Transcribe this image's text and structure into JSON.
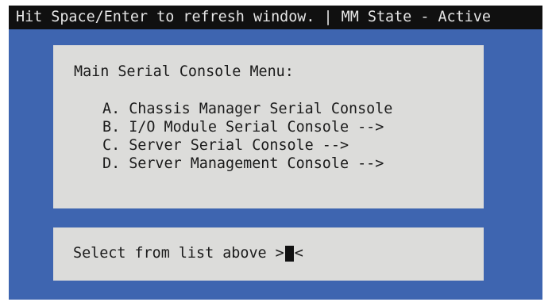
{
  "status_bar": {
    "left_text": "Hit Space/Enter to refresh window.",
    "separator": " | ",
    "right_text": "MM State - Active"
  },
  "menu": {
    "title": "Main Serial Console Menu:",
    "items": [
      {
        "label": "A. Chassis Manager Serial Console"
      },
      {
        "label": "B. I/O Module Serial Console -->"
      },
      {
        "label": "C. Server Serial Console -->"
      },
      {
        "label": "D. Server Management Console -->"
      }
    ]
  },
  "input": {
    "prompt": "Select from list above >",
    "value": "",
    "suffix": "<"
  },
  "colors": {
    "background_blue": "#3e65b0",
    "panel_gray": "#dcdcda",
    "status_bar_black": "#101010",
    "text_dark": "#1a1a1a"
  }
}
